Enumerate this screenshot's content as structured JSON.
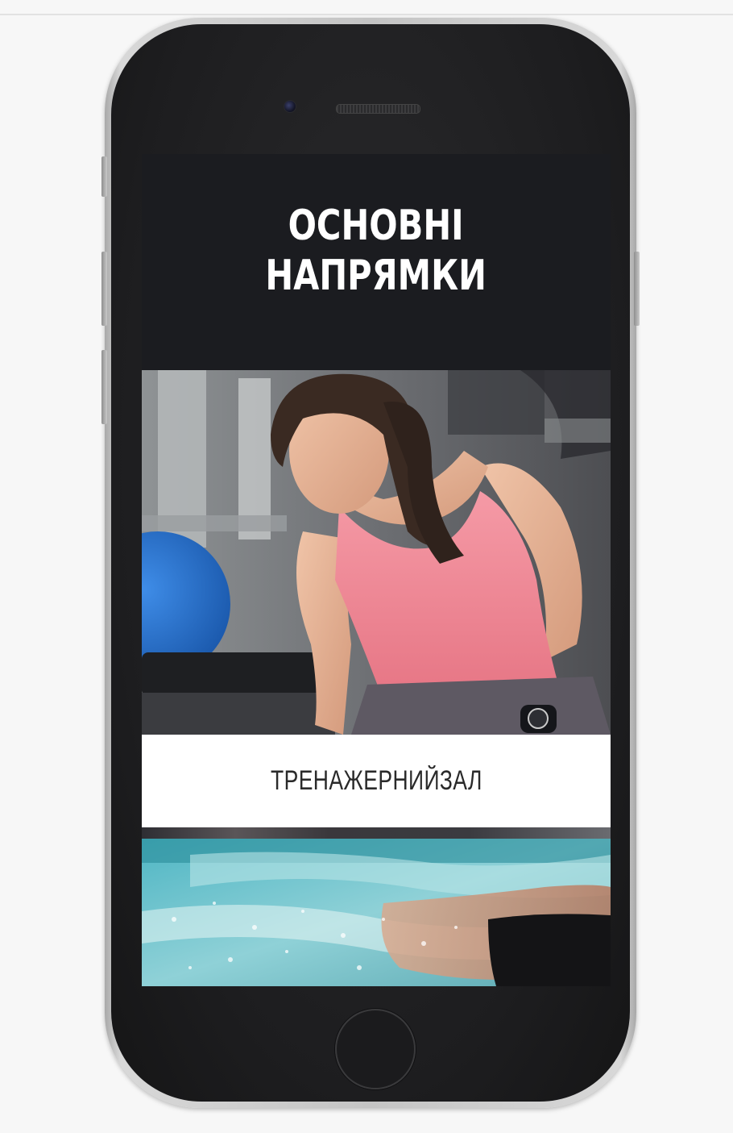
{
  "hero": {
    "title_line1": "ОСНОВНІ",
    "title_line2": "НАПРЯМКИ"
  },
  "cards": [
    {
      "label": "ТРЕНАЖЕРНИЙЗАЛ",
      "image": "woman-training-with-dumbbell-in-gym"
    },
    {
      "image": "swimmer-in-pool"
    }
  ],
  "colors": {
    "hero_background": "#1b1c20",
    "label_background": "#ffffff",
    "label_text": "#2a2a2a",
    "page_background": "#f7f7f7"
  }
}
